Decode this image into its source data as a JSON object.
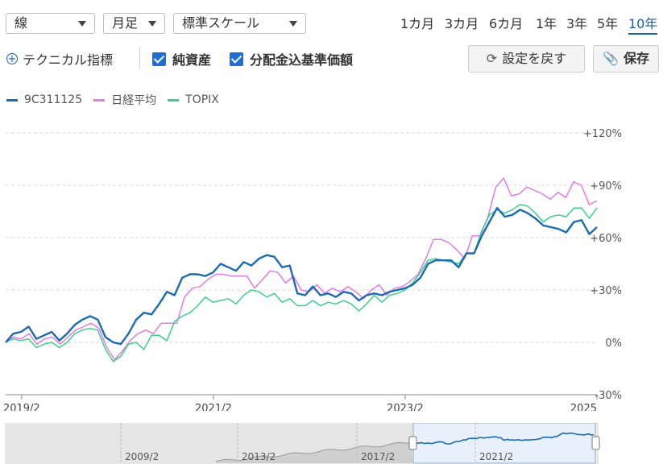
{
  "toolbar": {
    "chart_type": "線",
    "interval": "月足",
    "scale": "標準スケール",
    "periods": [
      "1カ月",
      "3カ月",
      "6カ月",
      "1年",
      "3年",
      "5年",
      "10年"
    ],
    "active_period": "10年",
    "technical_label": "テクニカル指標",
    "checkbox_nav": "純資産",
    "checkbox_dist": "分配金込基準価額",
    "reset_label": "設定を戻す",
    "save_label": "保存"
  },
  "colors": {
    "fund": "#1a6bb3",
    "nikkei": "#e07ce5",
    "topix": "#3ccf8a",
    "accent": "#1f6fd1"
  },
  "chart_data": {
    "type": "line",
    "x_start": "2018-12",
    "x_end": "2025-02",
    "x_ticks": [
      {
        "date": "2019-02",
        "label": "2019/2"
      },
      {
        "date": "2021-02",
        "label": "2021/2"
      },
      {
        "date": "2023-02",
        "label": "2023/2"
      },
      {
        "date": "2025-02",
        "label": "2025"
      }
    ],
    "y_ticks": [
      -30,
      0,
      30,
      60,
      90,
      120
    ],
    "y_tick_labels": [
      "-30%",
      "0%",
      "+30%",
      "+60%",
      "+90%",
      "+120%"
    ],
    "ylim": [
      -30,
      120
    ],
    "grid": true,
    "legend_position": "top-left",
    "series": [
      {
        "name": "9C311125",
        "values": [
          0,
          5,
          6,
          9,
          2,
          4,
          6,
          1,
          5,
          10,
          13,
          15,
          13,
          3,
          0,
          -1,
          5,
          13,
          17,
          16,
          22,
          29,
          27,
          37,
          39,
          39,
          38,
          40,
          45,
          43,
          41,
          46,
          44,
          48,
          50,
          49,
          43,
          44,
          28,
          27,
          32,
          27,
          28,
          26,
          29,
          28,
          24,
          27,
          28,
          27,
          29,
          30,
          31,
          33,
          37,
          45,
          47,
          47,
          47,
          43,
          51,
          51,
          61,
          69,
          77,
          72,
          73,
          76,
          74,
          71,
          67,
          66,
          65,
          63,
          69,
          70,
          62,
          66
        ]
      },
      {
        "name": "日経平均",
        "values": [
          0,
          3,
          2,
          5,
          -1,
          2,
          3,
          -1,
          3,
          7,
          9,
          11,
          8,
          -3,
          -10,
          -5,
          1,
          5,
          7,
          5,
          11,
          11,
          11,
          26,
          31,
          32,
          36,
          39,
          39,
          38,
          38,
          38,
          31,
          36,
          41,
          40,
          34,
          38,
          30,
          29,
          33,
          28,
          31,
          29,
          32,
          29,
          25,
          30,
          33,
          27,
          31,
          32,
          35,
          39,
          48,
          59,
          59,
          57,
          53,
          48,
          61,
          61,
          72,
          89,
          94,
          84,
          85,
          89,
          87,
          85,
          82,
          86,
          83,
          92,
          90,
          79,
          81
        ]
      },
      {
        "name": "TOPIX",
        "values": [
          0,
          2,
          1,
          2,
          -3,
          -1,
          0,
          -3,
          0,
          5,
          7,
          8,
          7,
          -4,
          -11,
          -8,
          -1,
          0,
          -4,
          4,
          4,
          1,
          12,
          15,
          17,
          21,
          26,
          23,
          24,
          25,
          22,
          27,
          30,
          29,
          26,
          28,
          23,
          25,
          21,
          21,
          24,
          21,
          23,
          22,
          24,
          22,
          18,
          22,
          27,
          23,
          27,
          28,
          30,
          34,
          40,
          47,
          48,
          47,
          46,
          45,
          51,
          51,
          64,
          73,
          76,
          74,
          76,
          79,
          78,
          74,
          69,
          72,
          73,
          72,
          77,
          77,
          71,
          77
        ]
      }
    ]
  },
  "navigator": {
    "labels": [
      "2009/2",
      "2013/2",
      "2017/2",
      "2021/2"
    ]
  }
}
